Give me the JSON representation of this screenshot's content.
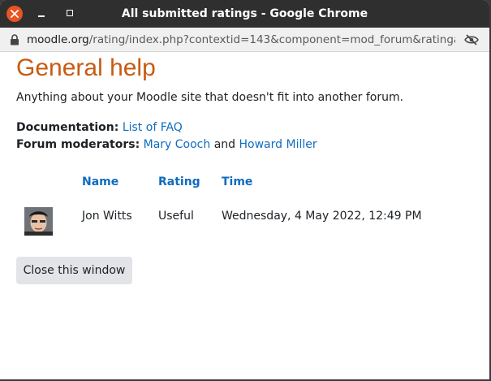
{
  "window": {
    "title": "All submitted ratings - Google Chrome"
  },
  "urlbar": {
    "host": "moodle.org",
    "path": "/rating/index.php?contextid=143&component=mod_forum&ratingare..."
  },
  "page": {
    "title": "General help",
    "intro": "Anything about your Moodle site that doesn't fit into another forum.",
    "documentation_label": "Documentation:",
    "documentation_link": "List of FAQ",
    "moderators_label": "Forum moderators:",
    "moderator_1": "Mary Cooch",
    "moderators_joiner": "and",
    "moderator_2": "Howard Miller"
  },
  "table": {
    "headers": [
      "Name",
      "Rating",
      "Time"
    ],
    "rows": [
      {
        "name": "Jon Witts",
        "rating": "Useful",
        "time": "Wednesday, 4 May 2022, 12:49 PM"
      }
    ]
  },
  "actions": {
    "close_label": "Close this window"
  },
  "colors": {
    "accent_title": "#c75b12",
    "link": "#0f6cbf",
    "titlebar": "#2f2f2f",
    "close_button": "#e95420"
  }
}
